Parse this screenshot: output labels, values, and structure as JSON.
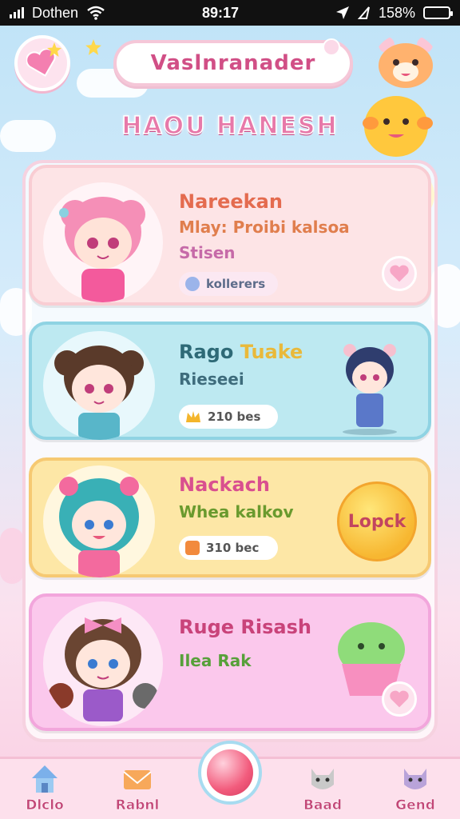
{
  "status_bar": {
    "carrier": "Dothen",
    "time": "89:17",
    "battery_text": "158%",
    "battery_level": 0.9
  },
  "search": {
    "value": "Vaslnranader"
  },
  "page_title": "HAOU HANESH",
  "cards": [
    {
      "title": "Nareekan",
      "subtitle_1": "Mlay: Proibi kalsoa",
      "subtitle_2": "Stisen",
      "pill_text": "kollerers",
      "accent": "#f7a8c8"
    },
    {
      "title_a": "Rago",
      "title_b": "Tuake",
      "subtitle": "Rieseei",
      "pill_text": "210 bes",
      "accent": "#8fd3e3"
    },
    {
      "title": "Nackach",
      "subtitle": "Whea kalkov",
      "pill_text": "310 bec",
      "button_label": "Lopck",
      "accent": "#f6c972"
    },
    {
      "title": "Ruge Risash",
      "subtitle": "Ilea Rak",
      "accent": "#f2a6dc"
    }
  ],
  "bottom_nav": {
    "items": [
      {
        "label": "Dlclo",
        "icon": "house-icon"
      },
      {
        "label": "Rabnl",
        "icon": "envelope-icon"
      },
      {
        "label": "Baad",
        "icon": "cat-icon"
      },
      {
        "label": "Gend",
        "icon": "kitten-icon"
      }
    ]
  }
}
